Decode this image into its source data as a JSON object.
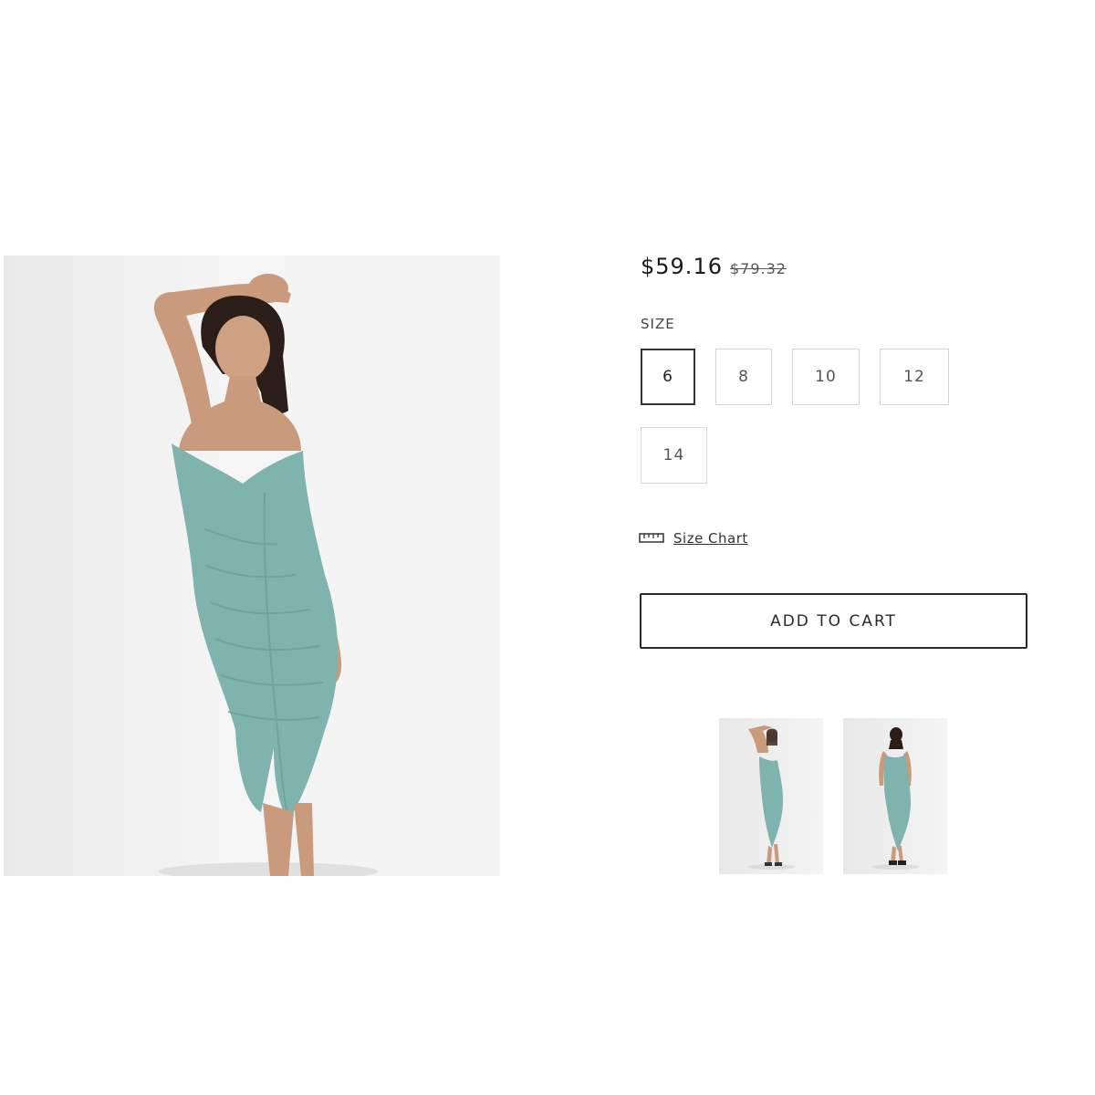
{
  "product": {
    "price_current": "$59.16",
    "price_original": "$79.32",
    "dress_color": "#7fb3ad"
  },
  "size": {
    "label": "SIZE",
    "options": [
      "6",
      "8",
      "10",
      "12",
      "14"
    ],
    "selected": "6"
  },
  "size_chart": {
    "label": "Size Chart",
    "icon": "ruler-icon"
  },
  "add_to_cart": {
    "label": "ADD TO CART"
  },
  "gallery": {
    "thumbnails": [
      "front-view",
      "back-view"
    ]
  }
}
